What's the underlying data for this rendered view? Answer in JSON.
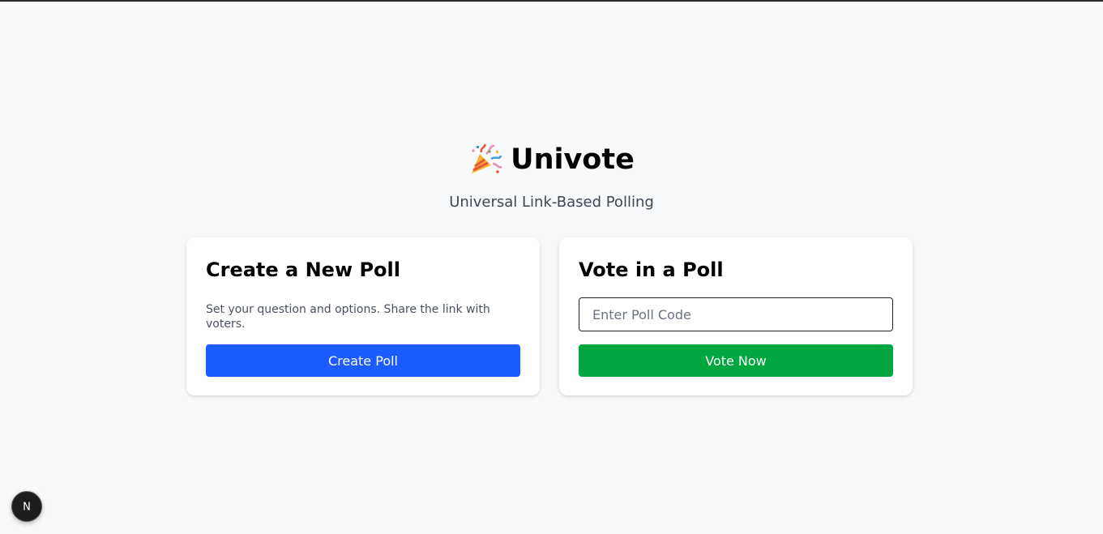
{
  "header": {
    "title": "Univote",
    "subtitle": "Universal Link-Based Polling",
    "icon": "party-popper-icon"
  },
  "create_card": {
    "title": "Create a New Poll",
    "description": "Set your question and options. Share the link with voters.",
    "button_label": "Create Poll",
    "button_color": "#1a5cff"
  },
  "vote_card": {
    "title": "Vote in a Poll",
    "input_placeholder": "Enter Poll Code",
    "input_value": "",
    "button_label": "Vote Now",
    "button_color": "#00a63e"
  },
  "dev_badge": {
    "label": "N",
    "icon": "nextjs-icon"
  },
  "colors": {
    "background": "#f8f9fb",
    "card": "#ffffff"
  }
}
